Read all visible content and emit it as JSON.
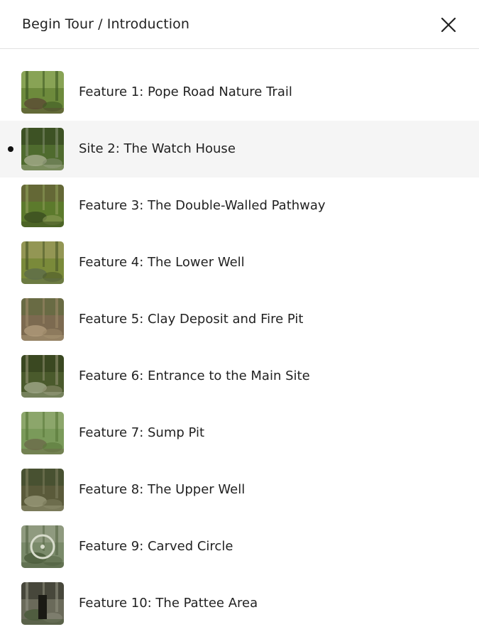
{
  "header": {
    "title": "Begin Tour / Introduction",
    "close_icon": "close-icon"
  },
  "tour": {
    "active_index": 1,
    "items": [
      {
        "label": "Feature 1: Pope Road Nature Trail",
        "thumb": "forest-trail"
      },
      {
        "label": "Site 2: The Watch House",
        "thumb": "stone-ruins"
      },
      {
        "label": "Feature 3: The Double-Walled Pathway",
        "thumb": "walled-path"
      },
      {
        "label": "Feature 4: The Lower Well",
        "thumb": "mossy-rocks"
      },
      {
        "label": "Feature 5: Clay Deposit and Fire Pit",
        "thumb": "clay-ground"
      },
      {
        "label": "Feature 6: Entrance to the Main Site",
        "thumb": "forest-entrance"
      },
      {
        "label": "Feature 7: Sump Pit",
        "thumb": "green-pit"
      },
      {
        "label": "Feature 8: The Upper Well",
        "thumb": "stone-well"
      },
      {
        "label": "Feature 9: Carved Circle",
        "thumb": "carved-stone"
      },
      {
        "label": "Feature 10: The Pattee Area",
        "thumb": "stone-chamber"
      }
    ]
  },
  "colors": {
    "active_row": "#f5f5f5",
    "divider": "#e2e2e2"
  }
}
